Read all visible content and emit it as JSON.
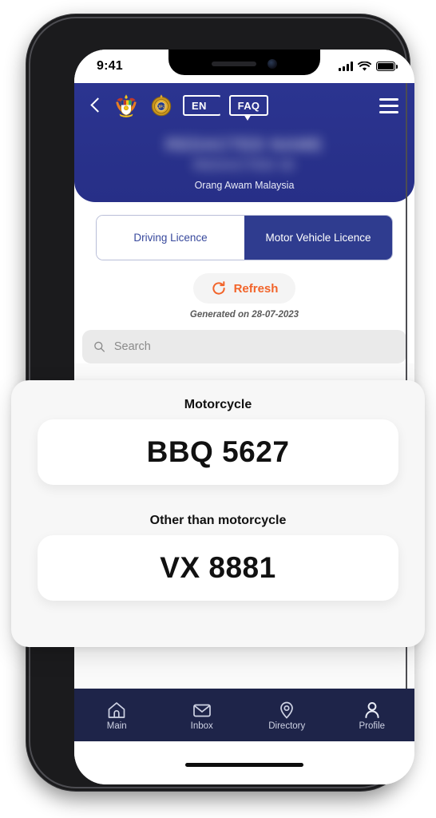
{
  "status_bar": {
    "time": "9:41",
    "signal_icon": "cellular-signal-icon",
    "wifi_icon": "wifi-icon",
    "battery_icon": "battery-full-icon"
  },
  "header": {
    "back_icon": "back-chevron-icon",
    "emblem_primary": "malaysia-coat-of-arms-emblem",
    "emblem_secondary": "jpj-department-emblem",
    "language_button": "EN",
    "faq_button": "FAQ",
    "menu_icon": "hamburger-menu-icon",
    "user_name_redacted": "REDACTED NAME",
    "user_id_redacted": "REDACTED ID",
    "user_role": "Orang Awam Malaysia",
    "background_color": "#2b3490"
  },
  "tabs": [
    {
      "label": "Driving Licence",
      "active": false
    },
    {
      "label": "Motor Vehicle Licence",
      "active": true
    }
  ],
  "refresh": {
    "label": "Refresh",
    "icon": "refresh-circular-arrow-icon",
    "accent_color": "#f2642a",
    "generated_on": "Generated on 28-07-2023"
  },
  "search": {
    "placeholder": "Search",
    "value": "",
    "icon": "search-magnifier-icon"
  },
  "plate_card": [
    {
      "caption": "Motorcycle",
      "plate": "BBQ 5627"
    },
    {
      "caption": "Other than motorcycle",
      "plate": "VX 8881"
    }
  ],
  "bottom_nav": [
    {
      "label": "Main",
      "icon": "home-icon"
    },
    {
      "label": "Inbox",
      "icon": "envelope-icon"
    },
    {
      "label": "Directory",
      "icon": "location-pin-icon"
    },
    {
      "label": "Profile",
      "icon": "person-icon"
    }
  ],
  "colors": {
    "header_blue": "#2b3490",
    "nav_navy": "#1e2449",
    "tab_active": "#2f3c8f",
    "accent_orange": "#f2642a"
  }
}
